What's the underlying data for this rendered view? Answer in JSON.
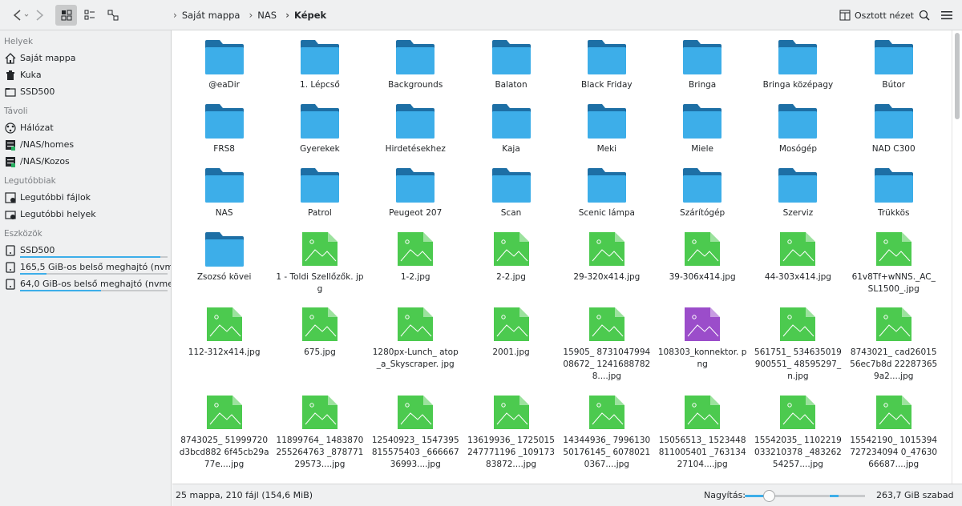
{
  "toolbar": {
    "breadcrumb": [
      "Saját mappa",
      "NAS",
      "Képek"
    ],
    "split_label": "Osztott nézet"
  },
  "sidebar": {
    "sections": [
      {
        "title": "Helyek",
        "items": [
          {
            "label": "Saját mappa",
            "icon": "home-icon"
          },
          {
            "label": "Kuka",
            "icon": "trash-icon"
          },
          {
            "label": "SSD500",
            "icon": "folder-icon"
          }
        ]
      },
      {
        "title": "Távoli",
        "items": [
          {
            "label": "Hálózat",
            "icon": "network-icon"
          },
          {
            "label": "/NAS/homes",
            "icon": "server-icon"
          },
          {
            "label": "/NAS/Kozos",
            "icon": "server-icon"
          }
        ]
      },
      {
        "title": "Legutóbbiak",
        "items": [
          {
            "label": "Legutóbbi fájlok",
            "icon": "recent-files-icon"
          },
          {
            "label": "Legutóbbi helyek",
            "icon": "recent-places-icon"
          }
        ]
      },
      {
        "title": "Eszközök",
        "items": [
          {
            "label": "SSD500",
            "icon": "drive-icon",
            "usage": 0.95
          },
          {
            "label": "165,5 GiB-os belső meghajtó (nvm...",
            "icon": "drive-icon",
            "usage": 0.18
          },
          {
            "label": "64,0 GiB-os belső meghajtó (nvme...",
            "icon": "drive-icon",
            "usage": 0.55
          }
        ]
      }
    ]
  },
  "files": [
    {
      "name": "@eaDir",
      "type": "folder"
    },
    {
      "name": "1. Lépcső",
      "type": "folder"
    },
    {
      "name": "Backgrounds",
      "type": "folder"
    },
    {
      "name": "Balaton",
      "type": "folder"
    },
    {
      "name": "Black Friday",
      "type": "folder"
    },
    {
      "name": "Bringa",
      "type": "folder"
    },
    {
      "name": "Bringa középagy",
      "type": "folder"
    },
    {
      "name": "Bútor",
      "type": "folder"
    },
    {
      "name": "FRS8",
      "type": "folder"
    },
    {
      "name": "Gyerekek",
      "type": "folder"
    },
    {
      "name": "Hirdetésekhez",
      "type": "folder"
    },
    {
      "name": "Kaja",
      "type": "folder"
    },
    {
      "name": "Meki",
      "type": "folder"
    },
    {
      "name": "Miele",
      "type": "folder"
    },
    {
      "name": "Mosógép",
      "type": "folder"
    },
    {
      "name": "NAD C300",
      "type": "folder"
    },
    {
      "name": "NAS",
      "type": "folder"
    },
    {
      "name": "Patrol",
      "type": "folder"
    },
    {
      "name": "Peugeot 207",
      "type": "folder"
    },
    {
      "name": "Scan",
      "type": "folder"
    },
    {
      "name": "Scenic lámpa",
      "type": "folder"
    },
    {
      "name": "Szárítógép",
      "type": "folder"
    },
    {
      "name": "Szerviz",
      "type": "folder"
    },
    {
      "name": "Trükkös",
      "type": "folder"
    },
    {
      "name": "Zsozsó kövei",
      "type": "folder"
    },
    {
      "name": "1 - Toldi Szellőzők. jpg",
      "type": "jpg"
    },
    {
      "name": "1-2.jpg",
      "type": "jpg"
    },
    {
      "name": "2-2.jpg",
      "type": "jpg"
    },
    {
      "name": "29-320x414.jpg",
      "type": "jpg"
    },
    {
      "name": "39-306x414.jpg",
      "type": "jpg"
    },
    {
      "name": "44-303x414.jpg",
      "type": "jpg"
    },
    {
      "name": "61v8Tf+wNNS._AC_ SL1500_.jpg",
      "type": "jpg"
    },
    {
      "name": "112-312x414.jpg",
      "type": "jpg"
    },
    {
      "name": "675.jpg",
      "type": "jpg"
    },
    {
      "name": "1280px-Lunch_ atop_a_Skyscraper. jpg",
      "type": "jpg"
    },
    {
      "name": "2001.jpg",
      "type": "jpg"
    },
    {
      "name": "15905_ 873104799408672_ 12416887828....jpg",
      "type": "jpg"
    },
    {
      "name": "108303_konnektor. png",
      "type": "png"
    },
    {
      "name": "561751_ 534635019900551_ 48595297_n.jpg",
      "type": "jpg"
    },
    {
      "name": "8743021_ cad2601556ec7b8d 222873659a2....jpg",
      "type": "jpg"
    },
    {
      "name": "8743025_ 51999720d3bcd882 6f45cb29a77e....jpg",
      "type": "jpg"
    },
    {
      "name": "11899764_ 1483870255264763 _87877129573....jpg",
      "type": "jpg"
    },
    {
      "name": "12540923_ 1547395815575403 _66666736993....jpg",
      "type": "jpg"
    },
    {
      "name": "13619936_ 1725015247771196 _10917383872....jpg",
      "type": "jpg"
    },
    {
      "name": "14344936_ 799613050176145_ 60780210367....jpg",
      "type": "jpg"
    },
    {
      "name": "15056513_ 1523448811005401 _76313427104....jpg",
      "type": "jpg"
    },
    {
      "name": "15542035_ 1102219033210378 _48326254257....jpg",
      "type": "jpg"
    },
    {
      "name": "15542190_ 1015394727234094 0_4763066687....jpg",
      "type": "jpg"
    }
  ],
  "status": {
    "summary": "25 mappa, 210 fájl (154,6 MiB)",
    "zoom_label": "Nagyítás:",
    "zoom_level": 0.28,
    "free_label": "263,7 GiB szabad",
    "free_fraction": 0.25
  },
  "colors": {
    "folder": "#3daee9",
    "folder_tab": "#1d6fa5",
    "image": "#4cca4f",
    "image_fold": "#8fe08f",
    "png": "#9b4dca",
    "accent": "#3daee9"
  }
}
